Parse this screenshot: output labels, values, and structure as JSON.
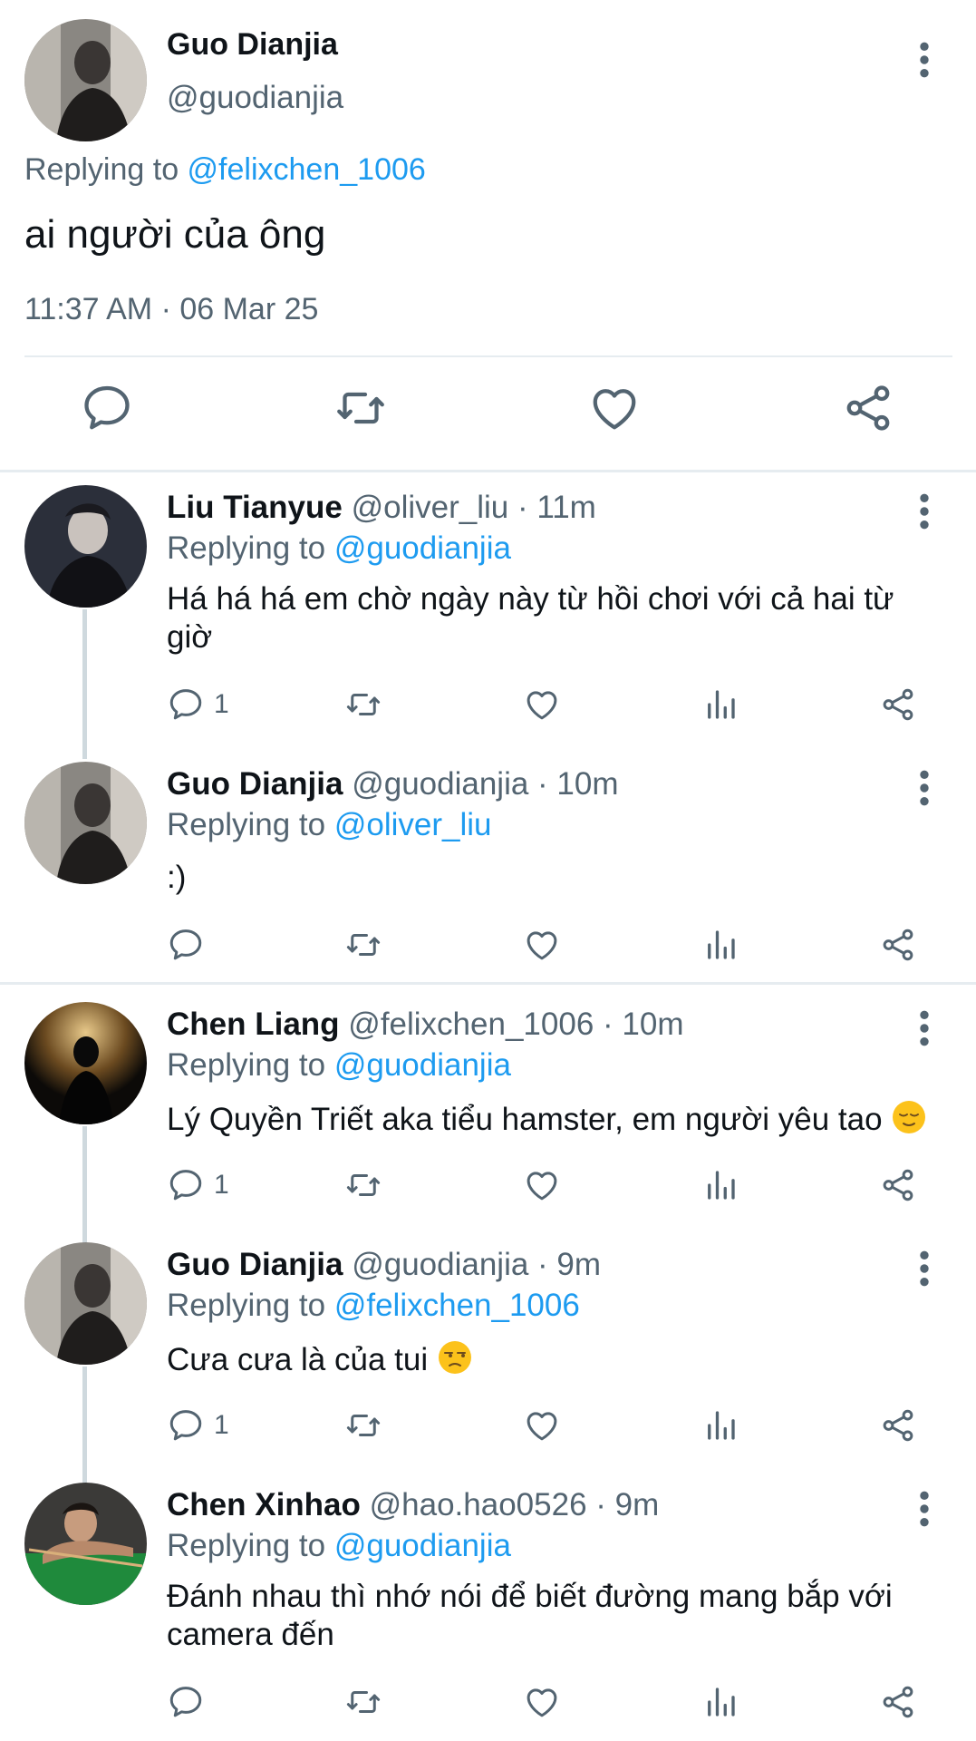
{
  "main": {
    "name": "Guo Dianjia",
    "handle": "@guodianjia",
    "replying_prefix": "Replying to ",
    "replying_to": "@felixchen_1006",
    "text": "ai người của ông",
    "timestamp": "11:37 AM · 06 Mar 25"
  },
  "replies": [
    {
      "name": "Liu Tianyue",
      "meta": " @oliver_liu · 11m",
      "replying_prefix": "Replying to ",
      "replying_to": "@guodianjia",
      "text": "Há há há em chờ ngày này từ hồi chơi với cả hai từ giờ",
      "reply_count": "1",
      "emoji": ""
    },
    {
      "name": "Guo Dianjia",
      "meta": " @guodianjia · 10m",
      "replying_prefix": "Replying to ",
      "replying_to": "@oliver_liu",
      "text": ":)",
      "reply_count": "",
      "emoji": ""
    },
    {
      "name": "Chen Liang",
      "meta": " @felixchen_1006 · 10m",
      "replying_prefix": "Replying to ",
      "replying_to": "@guodianjia",
      "text": "Lý Quyền Triết aka tiểu hamster, em người yêu tao ",
      "reply_count": "1",
      "emoji": "relieved-face"
    },
    {
      "name": "Guo Dianjia",
      "meta": " @guodianjia · 9m",
      "replying_prefix": "Replying to ",
      "replying_to": "@felixchen_1006",
      "text": "Cưa cưa là của tui ",
      "reply_count": "1",
      "emoji": "unamused-face"
    },
    {
      "name": "Chen Xinhao",
      "meta": " @hao.hao0526 · 9m",
      "replying_prefix": "Replying to ",
      "replying_to": "@guodianjia",
      "text": "Đánh nhau thì nhớ nói để biết đường mang bắp với camera đến",
      "reply_count": "",
      "emoji": ""
    }
  ],
  "colors": {
    "accent": "#1d9bf0",
    "secondary_text": "#536471",
    "divider": "#e6ecf0",
    "thread_line": "#cfd9de"
  },
  "icons": [
    "reply-icon",
    "retweet-icon",
    "like-icon",
    "analytics-icon",
    "share-icon",
    "more-icon"
  ]
}
